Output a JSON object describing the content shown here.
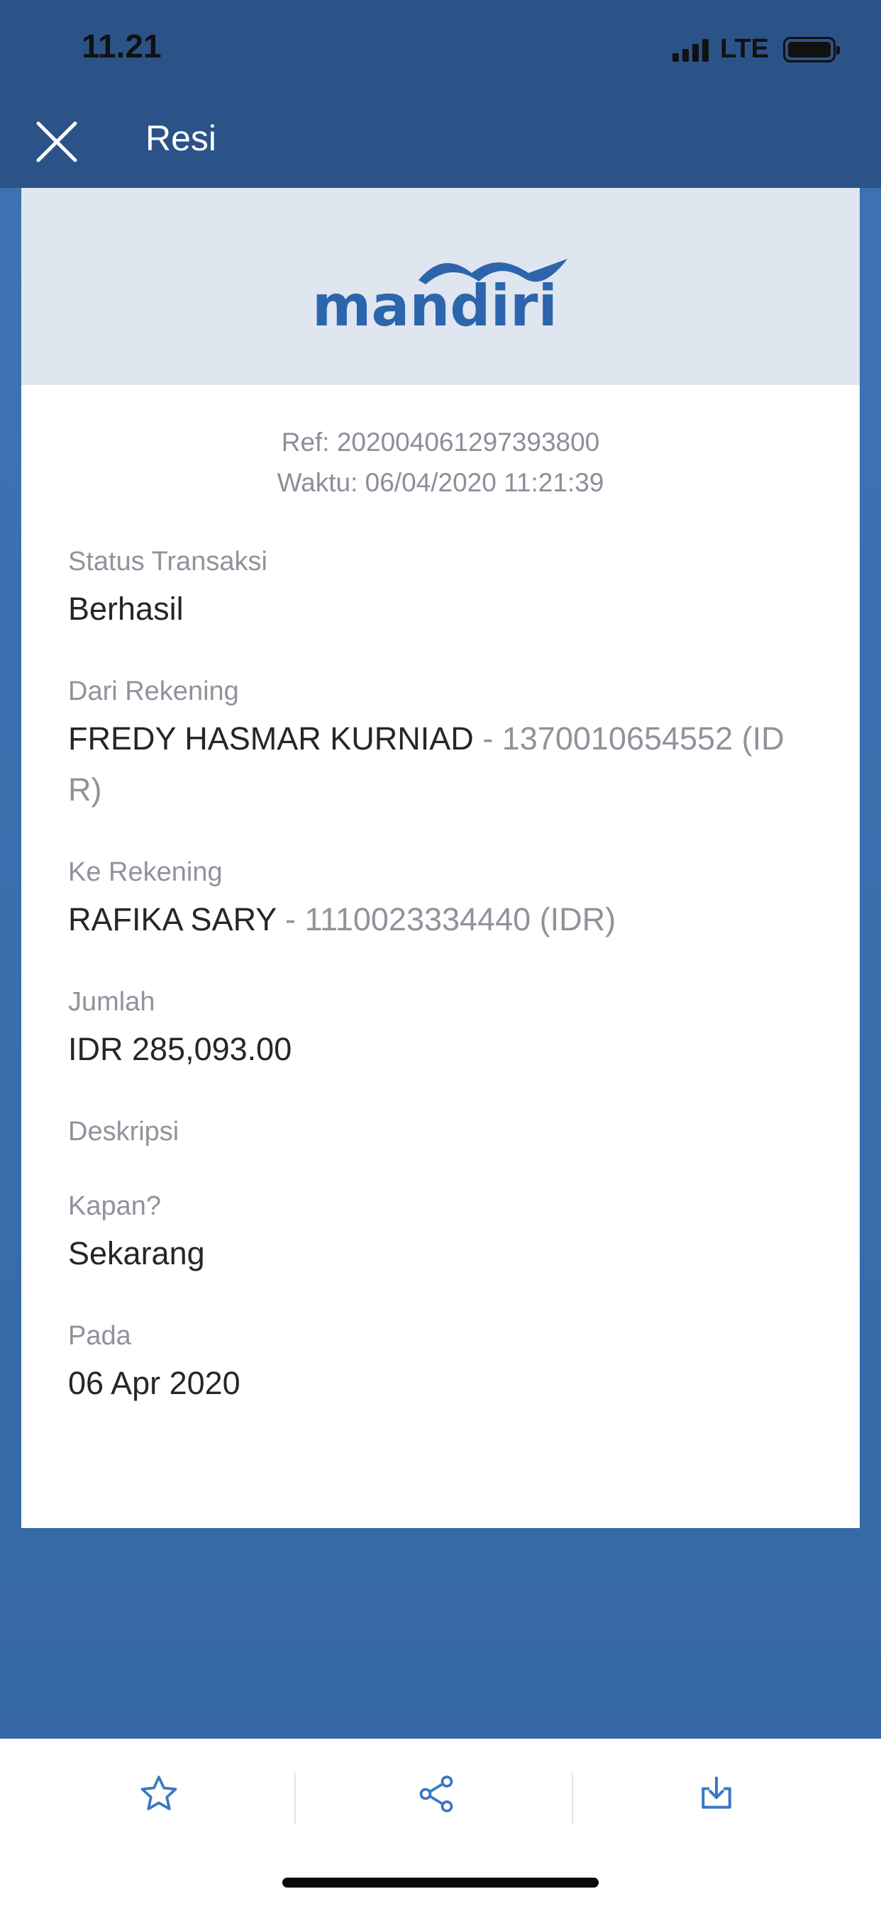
{
  "status_bar": {
    "time": "11.21",
    "network": "LTE"
  },
  "nav": {
    "title": "Resi"
  },
  "brand": {
    "name": "mandiri",
    "color": "#2d65ad"
  },
  "receipt": {
    "ref": "Ref: 202004061297393800",
    "time": "Waktu: 06/04/2020 11:21:39",
    "status_label": "Status Transaksi",
    "status_value": "Berhasil",
    "from_label": "Dari Rekening",
    "from_name": "FREDY HASMAR KURNIAD",
    "from_account": " - 1370010654552 (IDR)",
    "to_label": "Ke Rekening",
    "to_name": "RAFIKA SARY",
    "to_account": " - 1110023334440 (IDR)",
    "amount_label": "Jumlah",
    "amount_value": "IDR 285,093.00",
    "description_label": "Deskripsi",
    "when_label": "Kapan?",
    "when_value": "Sekarang",
    "date_label": "Pada",
    "date_value": "06 Apr 2020"
  },
  "actions": {
    "favorite_icon": "star-icon",
    "share_icon": "share-icon",
    "download_icon": "download-icon",
    "icon_color": "#3a78c2"
  }
}
